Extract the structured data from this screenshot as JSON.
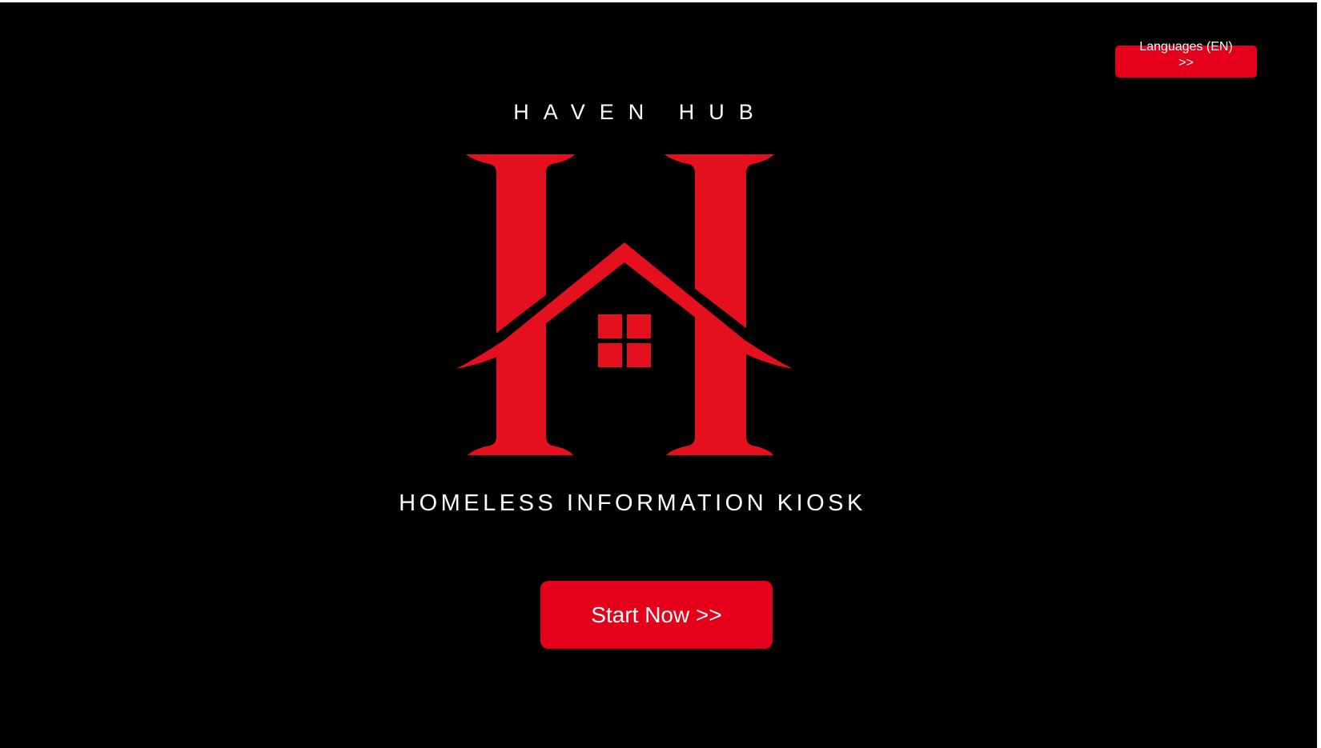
{
  "header": {
    "language_button_label": "Languages (EN)\n>>"
  },
  "branding": {
    "name": "HAVEN HUB",
    "subtitle": "HOMELESS INFORMATION KIOSK",
    "logo_icon": "house-h-logo-icon"
  },
  "main": {
    "start_button_label": "Start Now >>"
  },
  "colors": {
    "background": "#000000",
    "accent": "#e4001b",
    "text": "#ffffff"
  }
}
